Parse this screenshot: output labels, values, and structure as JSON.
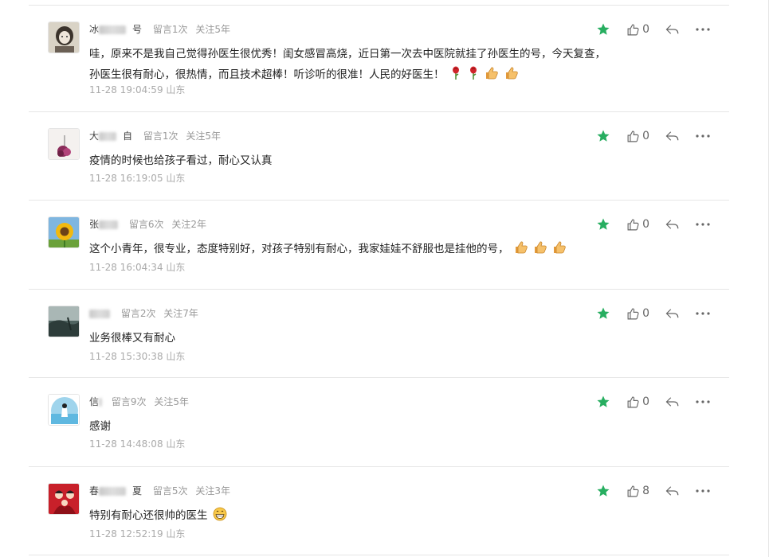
{
  "comments": [
    {
      "nickname_visible": "冰",
      "nickname_tail": "号",
      "messages": "留言1次",
      "follow": "关注5年",
      "text": "哇，原来不是我自己觉得孙医生很优秀！闺女感冒高烧，近日第一次去中医院就挂了孙医生的号，今天复查，孙医生很有耐心，很热情，而且技术超棒！听诊听的很准！人民的好医生！",
      "emojis": [
        "rose",
        "rose",
        "thumbs-up",
        "thumbs-up"
      ],
      "time": "11-28 19:04:59",
      "region": "山东",
      "likes": "0"
    },
    {
      "nickname_visible": "大",
      "nickname_tail": "自",
      "messages": "留言1次",
      "follow": "关注5年",
      "text": "疫情的时候也给孩子看过，耐心又认真",
      "emojis": [],
      "time": "11-28 16:19:05",
      "region": "山东",
      "likes": "0"
    },
    {
      "nickname_visible": "张",
      "nickname_tail": "",
      "messages": "留言6次",
      "follow": "关注2年",
      "text": "这个小青年，很专业，态度特别好，对孩子特别有耐心，我家娃娃不舒服也是挂他的号，",
      "emojis": [
        "thumbs-up",
        "thumbs-up",
        "thumbs-up"
      ],
      "time": "11-28 16:04:34",
      "region": "山东",
      "likes": "0"
    },
    {
      "nickname_visible": "",
      "nickname_tail": "",
      "messages": "留言2次",
      "follow": "关注7年",
      "text": "业务很棒又有耐心",
      "emojis": [],
      "time": "11-28 15:30:38",
      "region": "山东",
      "likes": "0"
    },
    {
      "nickname_visible": "信",
      "nickname_tail": "",
      "messages": "留言9次",
      "follow": "关注5年",
      "text": "感谢",
      "emojis": [],
      "time": "11-28 14:48:08",
      "region": "山东",
      "likes": "0"
    },
    {
      "nickname_visible": "春",
      "nickname_tail": "夏",
      "messages": "留言5次",
      "follow": "关注3年",
      "text": "特别有耐心还很帅的医生",
      "emojis": [
        "grin"
      ],
      "time": "11-28 12:52:19",
      "region": "山东",
      "likes": "8"
    }
  ],
  "icons": {
    "star": "star-icon",
    "like": "thumbs-up-icon",
    "reply": "reply-arrow-icon",
    "more": "more-dots-icon"
  },
  "colors": {
    "star": "#27ae60",
    "muted": "#999999",
    "divider": "#e6e6e6"
  }
}
